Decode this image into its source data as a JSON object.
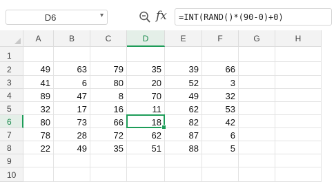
{
  "name_box": {
    "value": "D6"
  },
  "formula_bar": {
    "formula": "=INT(RAND()*(90-0)+0)"
  },
  "columns": [
    "A",
    "B",
    "C",
    "D",
    "E",
    "F",
    "G",
    "H"
  ],
  "rows": [
    {
      "label": "1",
      "values": [
        "",
        "",
        "",
        "",
        "",
        ""
      ]
    },
    {
      "label": "2",
      "values": [
        "49",
        "63",
        "79",
        "35",
        "39",
        "66"
      ]
    },
    {
      "label": "3",
      "values": [
        "41",
        "6",
        "80",
        "20",
        "52",
        "3"
      ]
    },
    {
      "label": "4",
      "values": [
        "89",
        "47",
        "8",
        "70",
        "49",
        "32"
      ]
    },
    {
      "label": "5",
      "values": [
        "32",
        "17",
        "16",
        "11",
        "62",
        "53"
      ]
    },
    {
      "label": "6",
      "values": [
        "80",
        "73",
        "66",
        "18",
        "82",
        "42"
      ]
    },
    {
      "label": "7",
      "values": [
        "78",
        "28",
        "72",
        "62",
        "87",
        "6"
      ]
    },
    {
      "label": "8",
      "values": [
        "22",
        "49",
        "35",
        "51",
        "88",
        "5"
      ]
    },
    {
      "label": "9",
      "values": [
        "",
        "",
        "",
        "",
        "",
        ""
      ]
    },
    {
      "label": "10",
      "values": [
        "",
        "",
        "",
        "",
        "",
        ""
      ]
    }
  ],
  "active_cell": {
    "column": "D",
    "row": "6"
  },
  "colors": {
    "accent": "#1d9c58",
    "header_bg": "#f3f3f3"
  }
}
